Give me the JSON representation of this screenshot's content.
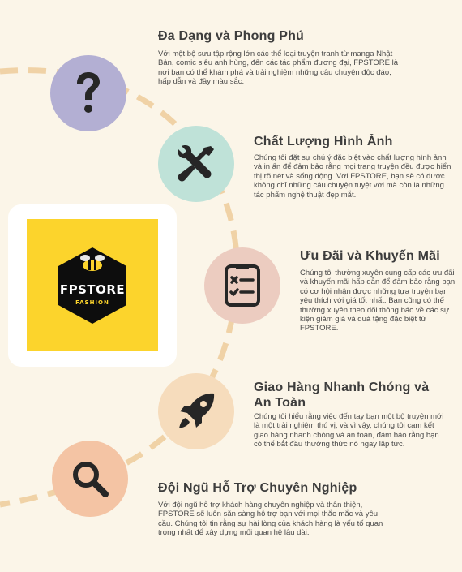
{
  "brand": {
    "name": "FPSTORE",
    "tagline": "FASHION"
  },
  "features": [
    {
      "icon": "question-icon",
      "circle_color": "#b3afd3",
      "title": "Đa Dạng và Phong Phú",
      "description": "Với một bộ sưu tập rộng lớn các thể loại truyện tranh từ manga Nhật Bản, comic siêu anh hùng, đến các tác phẩm đương đại, FPSTORE là nơi bạn có thể khám phá và trải nghiệm những câu chuyện độc đáo, hấp dẫn và đầy màu sắc."
    },
    {
      "icon": "tools-icon",
      "circle_color": "#bfe2d8",
      "title": "Chất Lượng Hình Ảnh",
      "description": "Chúng tôi đặt sự chú ý đặc biệt vào chất lượng hình ảnh và in ấn để đảm bảo rằng mọi trang truyện đều được hiển thị rõ nét và sống động. Với FPSTORE, bạn sẽ có được không chỉ những câu chuyện tuyệt vời mà còn là những tác phẩm nghệ thuật đẹp mắt."
    },
    {
      "icon": "checklist-icon",
      "circle_color": "#ecccc0",
      "title": "Ưu Đãi và Khuyến Mãi",
      "description": "Chúng tôi thường xuyên cung cấp các ưu đãi và khuyến mãi hấp dẫn để đảm bảo rằng bạn có cơ hội nhận được những tựa truyện bạn yêu thích với giá tốt nhất. Bạn cũng có thể thường xuyên theo dõi thông báo về các sự kiện giảm giá và quà tặng đặc biệt từ FPSTORE."
    },
    {
      "icon": "rocket-icon",
      "circle_color": "#f6dcbc",
      "title": "Giao Hàng Nhanh Chóng và An Toàn",
      "description": "Chúng tôi hiểu rằng việc đến tay bạn một bộ truyện mới là một trải nghiệm thú vị, và vì vậy, chúng tôi cam kết giao hàng nhanh chóng và an toàn, đảm bảo rằng bạn có thể bắt đầu thưởng thức nó ngay lập tức."
    },
    {
      "icon": "search-icon",
      "circle_color": "#f4c4a4",
      "title": "Đội Ngũ Hỗ Trợ Chuyên Nghiệp",
      "description": "Với đội ngũ hỗ trợ khách hàng chuyên nghiệp và thân thiện, FPSTORE sẽ luôn sẵn sàng hỗ trợ bạn với mọi thắc mắc và yêu cầu. Chúng tôi tin rằng sự hài lòng của khách hàng là yếu tố quan trọng nhất để xây dựng mối quan hệ lâu dài."
    }
  ],
  "colors": {
    "background": "#fbf5e8",
    "connector": "#f0d2a6",
    "logo_yellow": "#fcd42c",
    "icon_dark": "#262626"
  }
}
